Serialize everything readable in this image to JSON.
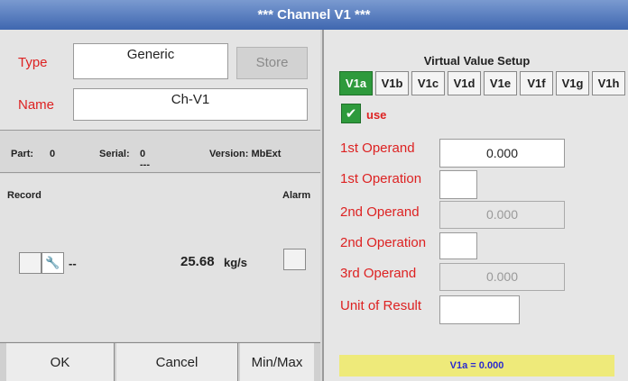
{
  "window": {
    "title": "*** Channel V1 ***"
  },
  "channel": {
    "type_label": "Type",
    "type_value": "Generic",
    "store_label": "Store",
    "name_label": "Name",
    "name_value": "Ch-V1"
  },
  "info": {
    "part_label": "Part:",
    "part_value": "0",
    "serial_label": "Serial:",
    "serial_value": "0",
    "serial_sub": "---",
    "version_label": "Version: MbExt"
  },
  "record": {
    "record_label": "Record",
    "alarm_label": "Alarm",
    "sensor_text": "--",
    "value": "25.68",
    "unit": "kg/s"
  },
  "buttons": {
    "ok": "OK",
    "cancel": "Cancel",
    "minmax": "Min/Max"
  },
  "virtual": {
    "title": "Virtual Value Setup",
    "tabs": [
      "V1a",
      "V1b",
      "V1c",
      "V1d",
      "V1e",
      "V1f",
      "V1g",
      "V1h"
    ],
    "active_tab": "V1a",
    "use_label": "use",
    "use_checked": true,
    "first_operand_label": "1st Operand",
    "first_operand_value": "0.000",
    "first_operation_label": "1st Operation",
    "first_operation_value": "",
    "second_operand_label": "2nd Operand",
    "second_operand_value": "0.000",
    "second_operation_label": "2nd Operation",
    "second_operation_value": "",
    "third_operand_label": "3rd Operand",
    "third_operand_value": "0.000",
    "unit_label": "Unit of Result",
    "unit_value": "",
    "result": "V1a = 0.000"
  },
  "colors": {
    "accent_red": "#dd2222",
    "active_green": "#2e9a3c",
    "title_blue": "#3f67b0",
    "result_yellow": "#eeea7a"
  },
  "icons": {
    "wrench": "wrench-icon",
    "check": "checkmark-icon"
  }
}
